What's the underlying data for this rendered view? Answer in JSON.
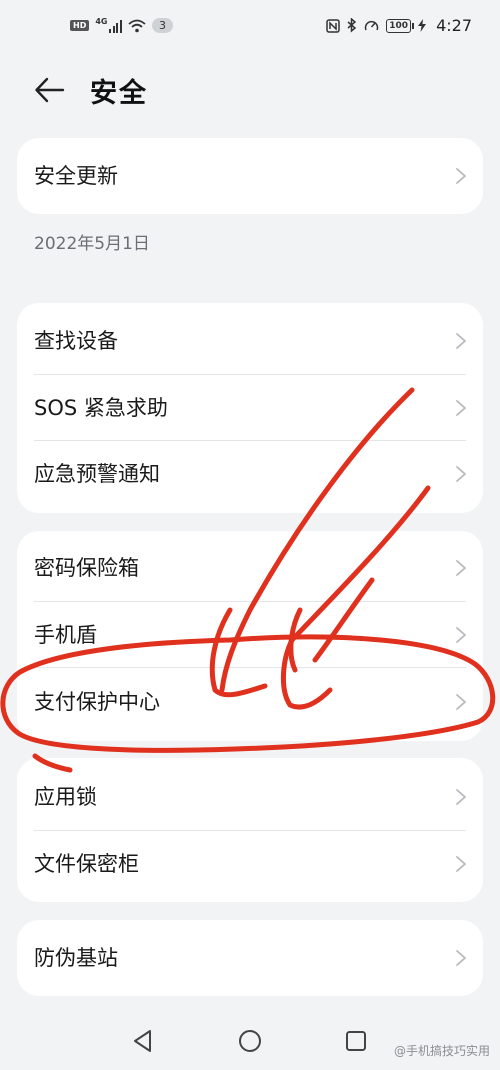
{
  "status_bar": {
    "hd": "HD",
    "network": "4G",
    "notif_count": "3",
    "battery": "100",
    "time": "4:27"
  },
  "header": {
    "title": "安全",
    "back_icon": "arrow-left-icon"
  },
  "security_update": {
    "label": "安全更新",
    "date": "2022年5月1日"
  },
  "group1": [
    {
      "label": "查找设备"
    },
    {
      "label": "SOS 紧急求助"
    },
    {
      "label": "应急预警通知"
    }
  ],
  "group2": [
    {
      "label": "密码保险箱"
    },
    {
      "label": "手机盾"
    },
    {
      "label": "支付保护中心"
    }
  ],
  "group3": [
    {
      "label": "应用锁"
    },
    {
      "label": "文件保密柜"
    }
  ],
  "group4": [
    {
      "label": "防伪基站"
    }
  ],
  "nav": {
    "icons": [
      "back-triangle-icon",
      "home-circle-icon",
      "recents-square-icon"
    ]
  },
  "watermark": "@手机搞技巧实用",
  "colors": {
    "background": "#f1f3f5",
    "card": "#ffffff",
    "annotation": "#e0301e"
  }
}
